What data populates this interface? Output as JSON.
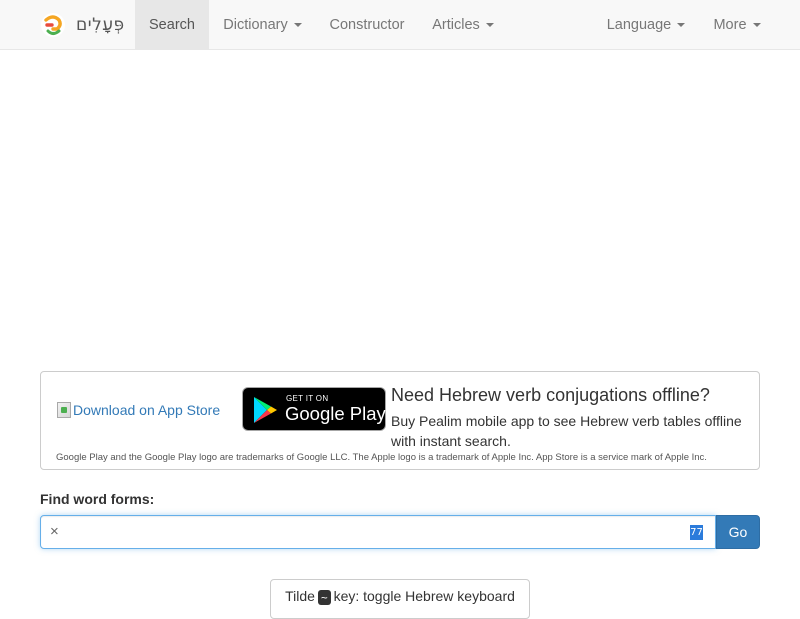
{
  "nav": {
    "brand_name": "פְּעָלִים",
    "search": "Search",
    "dictionary": "Dictionary",
    "constructor": "Constructor",
    "articles": "Articles",
    "language": "Language",
    "more": "More"
  },
  "promo": {
    "appstore_alt": "Download on App Store",
    "gplay_small": "GET IT ON",
    "gplay_big": "Google Play",
    "title": "Need Hebrew verb conjugations offline?",
    "description": "Buy Pealim mobile app to see Hebrew verb tables offline with instant search.",
    "legal": "Google Play and the Google Play logo are trademarks of Google LLC. The Apple logo is a trademark of Apple Inc. App Store is a service mark of Apple Inc."
  },
  "search": {
    "label": "Find word forms:",
    "clear": "×",
    "value": "",
    "keyboard_icon": "77",
    "go_label": "Go"
  },
  "hint": {
    "prefix": "Tilde",
    "key": "~",
    "suffix": "key: toggle Hebrew keyboard"
  },
  "colors": {
    "navbar_bg": "#f8f8f8",
    "active_tab_bg": "#e7e7e7",
    "primary": "#337ab7",
    "logo_orange": "#f5a623",
    "logo_red": "#e94b3c"
  }
}
